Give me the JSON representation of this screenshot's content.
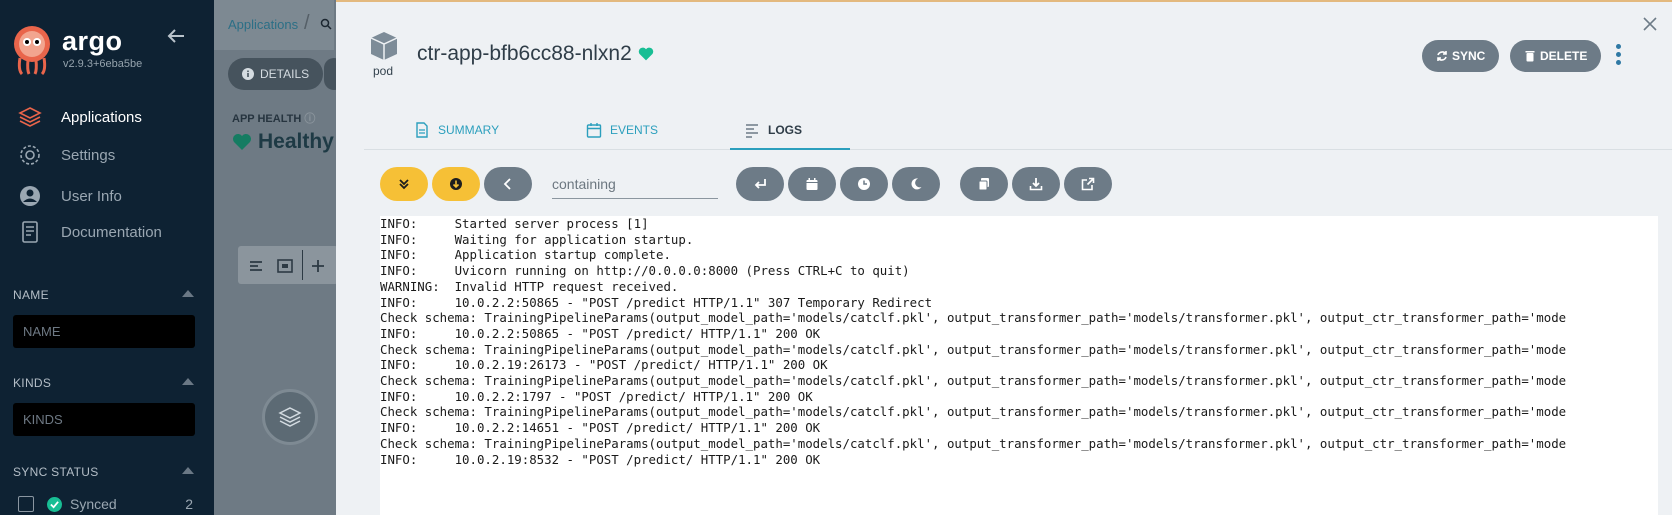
{
  "sidebar": {
    "brand": "argo",
    "version": "v2.9.3+6eba5be",
    "nav": [
      {
        "label": "Applications",
        "icon": "stack-icon"
      },
      {
        "label": "Settings",
        "icon": "gear-icon"
      },
      {
        "label": "User Info",
        "icon": "user-icon"
      },
      {
        "label": "Documentation",
        "icon": "book-icon"
      }
    ],
    "filters": {
      "name_title": "NAME",
      "name_placeholder": "NAME",
      "kinds_title": "KINDS",
      "kinds_placeholder": "KINDS",
      "sync_title": "SYNC STATUS",
      "synced_label": "Synced",
      "synced_count": "2"
    }
  },
  "background": {
    "breadcrumb": "Applications",
    "details_button": "DETAILS",
    "app_health_label": "APP HEALTH",
    "app_health_value": "Healthy"
  },
  "panel": {
    "kind": "pod",
    "title": "ctr-app-bfb6cc88-nlxn2",
    "sync_button": "SYNC",
    "delete_button": "DELETE",
    "tabs": [
      "SUMMARY",
      "EVENTS",
      "LOGS"
    ],
    "active_tab": "LOGS",
    "filter_placeholder": "containing",
    "accent_color": "#2b9fbd",
    "healthy_color": "#18be94"
  },
  "logs": [
    "INFO:     Started server process [1]",
    "INFO:     Waiting for application startup.",
    "INFO:     Application startup complete.",
    "INFO:     Uvicorn running on http://0.0.0.0:8000 (Press CTRL+C to quit)",
    "WARNING:  Invalid HTTP request received.",
    "INFO:     10.0.2.2:50865 - \"POST /predict HTTP/1.1\" 307 Temporary Redirect",
    "Check schema: TrainingPipelineParams(output_model_path='models/catclf.pkl', output_transformer_path='models/transformer.pkl', output_ctr_transformer_path='mode",
    "INFO:     10.0.2.2:50865 - \"POST /predict/ HTTP/1.1\" 200 OK",
    "Check schema: TrainingPipelineParams(output_model_path='models/catclf.pkl', output_transformer_path='models/transformer.pkl', output_ctr_transformer_path='mode",
    "INFO:     10.0.2.19:26173 - \"POST /predict/ HTTP/1.1\" 200 OK",
    "Check schema: TrainingPipelineParams(output_model_path='models/catclf.pkl', output_transformer_path='models/transformer.pkl', output_ctr_transformer_path='mode",
    "INFO:     10.0.2.2:1797 - \"POST /predict/ HTTP/1.1\" 200 OK",
    "Check schema: TrainingPipelineParams(output_model_path='models/catclf.pkl', output_transformer_path='models/transformer.pkl', output_ctr_transformer_path='mode",
    "INFO:     10.0.2.2:14651 - \"POST /predict/ HTTP/1.1\" 200 OK",
    "Check schema: TrainingPipelineParams(output_model_path='models/catclf.pkl', output_transformer_path='models/transformer.pkl', output_ctr_transformer_path='mode",
    "INFO:     10.0.2.19:8532 - \"POST /predict/ HTTP/1.1\" 200 OK"
  ]
}
